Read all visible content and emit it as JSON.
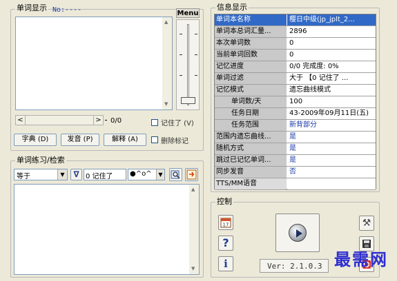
{
  "word_display": {
    "title": "单词显示",
    "counter": "No:----",
    "menu_label": "Menu",
    "page_count": "0/0",
    "remembered_label": "记住了 (V)",
    "buttons": {
      "dictionary": "字典 (D)",
      "pronounce": "发音 (P)",
      "explain": "解释 (A)"
    },
    "delete_mark_label": "删除标记"
  },
  "practice": {
    "title": "单词练习/检索",
    "match_select": "等于",
    "filter_select": "0 记住了",
    "mark_select": "●^o^"
  },
  "info": {
    "title": "信息显示",
    "rows": [
      {
        "label": "单词本名称",
        "value": "樱日中级(jp_jplt_2...",
        "selected": true
      },
      {
        "label": "单词本总词汇量...",
        "value": "2896"
      },
      {
        "label": "本次单词数",
        "value": "0"
      },
      {
        "label": "当前单词回数",
        "value": "0"
      },
      {
        "label": "记忆进度",
        "value": "0/0        完成度: 0%"
      },
      {
        "label": "单词过滤",
        "value": "大于  【0 记住了  ..."
      },
      {
        "label": "记忆模式",
        "value": "遗忘曲线模式"
      },
      {
        "label": "单词数/天",
        "value": "100",
        "indent": true
      },
      {
        "label": "任务日期",
        "value": "43-2009年09月11日(五)",
        "indent": true
      },
      {
        "label": "任务范围",
        "value": "新背部分",
        "indent": true,
        "blue": true
      },
      {
        "label": "范围内遗忘曲线...",
        "value": "是",
        "blue": true
      },
      {
        "label": "随机方式",
        "value": "是",
        "blue": true
      },
      {
        "label": "跳过已记忆单词...",
        "value": "是",
        "blue": true
      },
      {
        "label": "同步发音",
        "value": "否",
        "blue": true
      },
      {
        "label": "TTS/MM语音",
        "value": ""
      }
    ]
  },
  "control": {
    "title": "控制",
    "version": "Ver: 2.1.0.3",
    "watermark": "最需网"
  },
  "colors": {
    "selection": "#3169c6",
    "face": "#ece9d8",
    "label_bg": "#c9c9c9",
    "link": "#1a3aa8"
  }
}
